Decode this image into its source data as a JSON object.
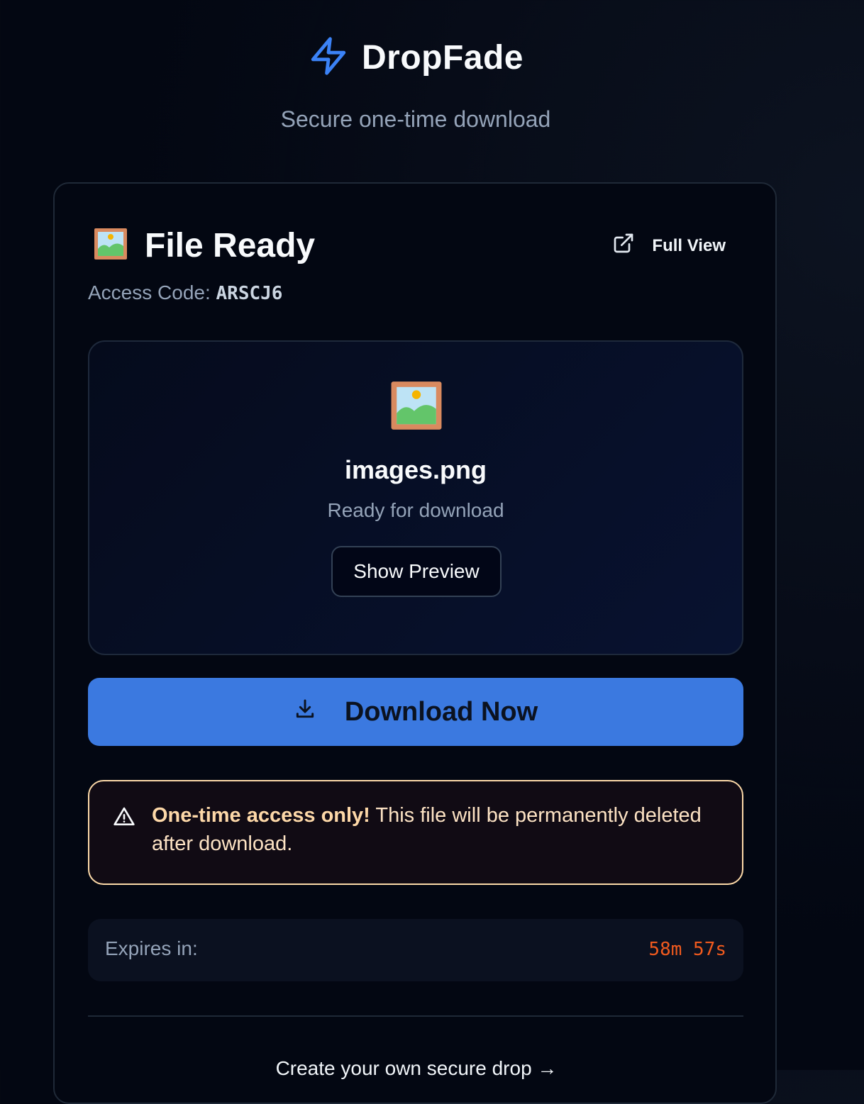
{
  "brand": {
    "name": "DropFade",
    "tagline": "Secure one-time download",
    "accent": "#3b82f6"
  },
  "card": {
    "title": "File Ready",
    "full_view_label": "Full View",
    "access_label": "Access Code:",
    "access_code": "ARSCJ6"
  },
  "file": {
    "name": "images.png",
    "status": "Ready for download",
    "show_preview_label": "Show Preview"
  },
  "download": {
    "label": "Download Now",
    "color": "#3b79e0"
  },
  "warning": {
    "bold": "One-time access only!",
    "text": "This file will be permanently deleted after download."
  },
  "expires": {
    "label": "Expires in:",
    "value": "58m 57s"
  },
  "footer": {
    "create_link": "Create your own secure drop →"
  },
  "icons": {
    "logo": "lightning-icon",
    "file": "framed-picture-icon",
    "full_view": "external-link-icon",
    "download": "download-icon",
    "warning": "warning-triangle-icon"
  }
}
